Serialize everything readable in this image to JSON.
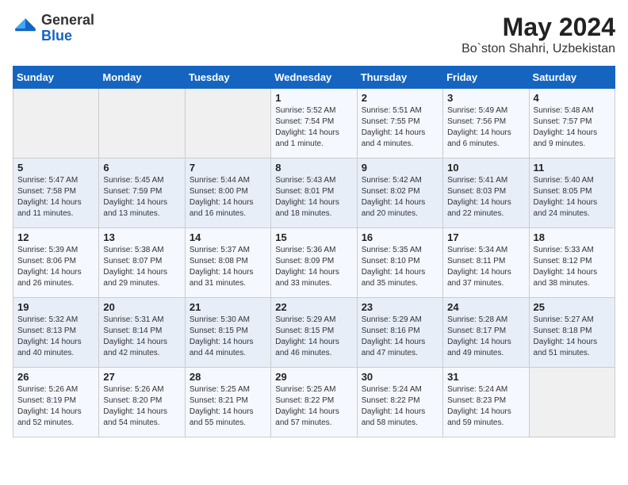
{
  "logo": {
    "general": "General",
    "blue": "Blue"
  },
  "title": {
    "month_year": "May 2024",
    "location": "Bo`ston Shahri, Uzbekistan"
  },
  "days_of_week": [
    "Sunday",
    "Monday",
    "Tuesday",
    "Wednesday",
    "Thursday",
    "Friday",
    "Saturday"
  ],
  "weeks": [
    [
      {
        "day": "",
        "info": ""
      },
      {
        "day": "",
        "info": ""
      },
      {
        "day": "",
        "info": ""
      },
      {
        "day": "1",
        "info": "Sunrise: 5:52 AM\nSunset: 7:54 PM\nDaylight: 14 hours and 1 minute."
      },
      {
        "day": "2",
        "info": "Sunrise: 5:51 AM\nSunset: 7:55 PM\nDaylight: 14 hours and 4 minutes."
      },
      {
        "day": "3",
        "info": "Sunrise: 5:49 AM\nSunset: 7:56 PM\nDaylight: 14 hours and 6 minutes."
      },
      {
        "day": "4",
        "info": "Sunrise: 5:48 AM\nSunset: 7:57 PM\nDaylight: 14 hours and 9 minutes."
      }
    ],
    [
      {
        "day": "5",
        "info": "Sunrise: 5:47 AM\nSunset: 7:58 PM\nDaylight: 14 hours and 11 minutes."
      },
      {
        "day": "6",
        "info": "Sunrise: 5:45 AM\nSunset: 7:59 PM\nDaylight: 14 hours and 13 minutes."
      },
      {
        "day": "7",
        "info": "Sunrise: 5:44 AM\nSunset: 8:00 PM\nDaylight: 14 hours and 16 minutes."
      },
      {
        "day": "8",
        "info": "Sunrise: 5:43 AM\nSunset: 8:01 PM\nDaylight: 14 hours and 18 minutes."
      },
      {
        "day": "9",
        "info": "Sunrise: 5:42 AM\nSunset: 8:02 PM\nDaylight: 14 hours and 20 minutes."
      },
      {
        "day": "10",
        "info": "Sunrise: 5:41 AM\nSunset: 8:03 PM\nDaylight: 14 hours and 22 minutes."
      },
      {
        "day": "11",
        "info": "Sunrise: 5:40 AM\nSunset: 8:05 PM\nDaylight: 14 hours and 24 minutes."
      }
    ],
    [
      {
        "day": "12",
        "info": "Sunrise: 5:39 AM\nSunset: 8:06 PM\nDaylight: 14 hours and 26 minutes."
      },
      {
        "day": "13",
        "info": "Sunrise: 5:38 AM\nSunset: 8:07 PM\nDaylight: 14 hours and 29 minutes."
      },
      {
        "day": "14",
        "info": "Sunrise: 5:37 AM\nSunset: 8:08 PM\nDaylight: 14 hours and 31 minutes."
      },
      {
        "day": "15",
        "info": "Sunrise: 5:36 AM\nSunset: 8:09 PM\nDaylight: 14 hours and 33 minutes."
      },
      {
        "day": "16",
        "info": "Sunrise: 5:35 AM\nSunset: 8:10 PM\nDaylight: 14 hours and 35 minutes."
      },
      {
        "day": "17",
        "info": "Sunrise: 5:34 AM\nSunset: 8:11 PM\nDaylight: 14 hours and 37 minutes."
      },
      {
        "day": "18",
        "info": "Sunrise: 5:33 AM\nSunset: 8:12 PM\nDaylight: 14 hours and 38 minutes."
      }
    ],
    [
      {
        "day": "19",
        "info": "Sunrise: 5:32 AM\nSunset: 8:13 PM\nDaylight: 14 hours and 40 minutes."
      },
      {
        "day": "20",
        "info": "Sunrise: 5:31 AM\nSunset: 8:14 PM\nDaylight: 14 hours and 42 minutes."
      },
      {
        "day": "21",
        "info": "Sunrise: 5:30 AM\nSunset: 8:15 PM\nDaylight: 14 hours and 44 minutes."
      },
      {
        "day": "22",
        "info": "Sunrise: 5:29 AM\nSunset: 8:15 PM\nDaylight: 14 hours and 46 minutes."
      },
      {
        "day": "23",
        "info": "Sunrise: 5:29 AM\nSunset: 8:16 PM\nDaylight: 14 hours and 47 minutes."
      },
      {
        "day": "24",
        "info": "Sunrise: 5:28 AM\nSunset: 8:17 PM\nDaylight: 14 hours and 49 minutes."
      },
      {
        "day": "25",
        "info": "Sunrise: 5:27 AM\nSunset: 8:18 PM\nDaylight: 14 hours and 51 minutes."
      }
    ],
    [
      {
        "day": "26",
        "info": "Sunrise: 5:26 AM\nSunset: 8:19 PM\nDaylight: 14 hours and 52 minutes."
      },
      {
        "day": "27",
        "info": "Sunrise: 5:26 AM\nSunset: 8:20 PM\nDaylight: 14 hours and 54 minutes."
      },
      {
        "day": "28",
        "info": "Sunrise: 5:25 AM\nSunset: 8:21 PM\nDaylight: 14 hours and 55 minutes."
      },
      {
        "day": "29",
        "info": "Sunrise: 5:25 AM\nSunset: 8:22 PM\nDaylight: 14 hours and 57 minutes."
      },
      {
        "day": "30",
        "info": "Sunrise: 5:24 AM\nSunset: 8:22 PM\nDaylight: 14 hours and 58 minutes."
      },
      {
        "day": "31",
        "info": "Sunrise: 5:24 AM\nSunset: 8:23 PM\nDaylight: 14 hours and 59 minutes."
      },
      {
        "day": "",
        "info": ""
      }
    ]
  ]
}
